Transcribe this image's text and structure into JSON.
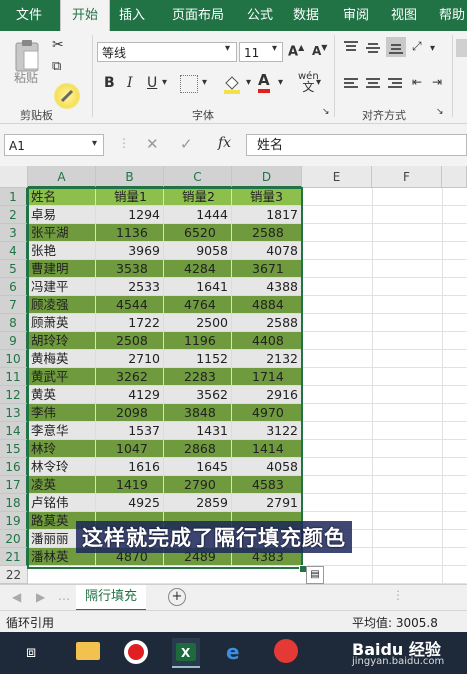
{
  "ribbon_tabs": [
    "文件",
    "开始",
    "插入",
    "页面布局",
    "公式",
    "数据",
    "审阅",
    "视图",
    "帮助"
  ],
  "active_tab": "开始",
  "clipboard": {
    "paste_label": "粘贴",
    "group_label": "剪贴板"
  },
  "font": {
    "name": "等线",
    "size": "11",
    "group_label": "字体",
    "bold": "B",
    "italic": "I",
    "underline": "U"
  },
  "alignment": {
    "group_label": "对齐方式"
  },
  "name_box": "A1",
  "formula_icon": "fx",
  "formula_value": "姓名",
  "columns": [
    "A",
    "B",
    "C",
    "D",
    "E",
    "F"
  ],
  "rows": [
    "1",
    "2",
    "3",
    "4",
    "5",
    "6",
    "7",
    "8",
    "9",
    "10",
    "11",
    "12",
    "13",
    "14",
    "15",
    "16",
    "17",
    "18",
    "19",
    "20",
    "21",
    "22"
  ],
  "table": [
    {
      "name": "姓名",
      "v1": "销量1",
      "v2": "销量2",
      "v3": "销量3"
    },
    {
      "name": "卓易",
      "v1": "1294",
      "v2": "1444",
      "v3": "1817"
    },
    {
      "name": "张平湖",
      "v1": "1136",
      "v2": "6520",
      "v3": "2588"
    },
    {
      "name": "张艳",
      "v1": "3969",
      "v2": "9058",
      "v3": "4078"
    },
    {
      "name": "曹建明",
      "v1": "3538",
      "v2": "4284",
      "v3": "3671"
    },
    {
      "name": "冯建平",
      "v1": "2533",
      "v2": "1641",
      "v3": "4388"
    },
    {
      "name": "顾凌强",
      "v1": "4544",
      "v2": "4764",
      "v3": "4884"
    },
    {
      "name": "顾萧英",
      "v1": "1722",
      "v2": "2500",
      "v3": "2588"
    },
    {
      "name": "胡玲玲",
      "v1": "2508",
      "v2": "1196",
      "v3": "4408"
    },
    {
      "name": "黄梅英",
      "v1": "2710",
      "v2": "1152",
      "v3": "2132"
    },
    {
      "name": "黄武平",
      "v1": "3262",
      "v2": "2283",
      "v3": "1714"
    },
    {
      "name": "黄英",
      "v1": "4129",
      "v2": "3562",
      "v3": "2916"
    },
    {
      "name": "李伟",
      "v1": "2098",
      "v2": "3848",
      "v3": "4970"
    },
    {
      "name": "李意华",
      "v1": "1537",
      "v2": "1431",
      "v3": "3122"
    },
    {
      "name": "林玲",
      "v1": "1047",
      "v2": "2868",
      "v3": "1414"
    },
    {
      "name": "林令玲",
      "v1": "1616",
      "v2": "1645",
      "v3": "4058"
    },
    {
      "name": "凌英",
      "v1": "1419",
      "v2": "2790",
      "v3": "4583"
    },
    {
      "name": "卢铭伟",
      "v1": "4925",
      "v2": "2859",
      "v3": "2791"
    },
    {
      "name": "路莫英",
      "v1": "",
      "v2": "",
      "v3": ""
    },
    {
      "name": "潘丽丽",
      "v1": "",
      "v2": "",
      "v3": ""
    },
    {
      "name": "潘林英",
      "v1": "4870",
      "v2": "2489",
      "v3": "4383"
    }
  ],
  "caption": "这样就完成了隔行填充颜色",
  "sheet_tab": "隔行填充",
  "status_left": "循环引用",
  "status_avg": "平均值: 3005.8",
  "watermark": "Baidu 经验",
  "watermark_url": "jingyan.baidu.com",
  "colors": {
    "band_green": "#6f9a3d",
    "band_gray": "#e6e6e6",
    "header_green": "#8cbf4c",
    "excel_green": "#217346"
  }
}
